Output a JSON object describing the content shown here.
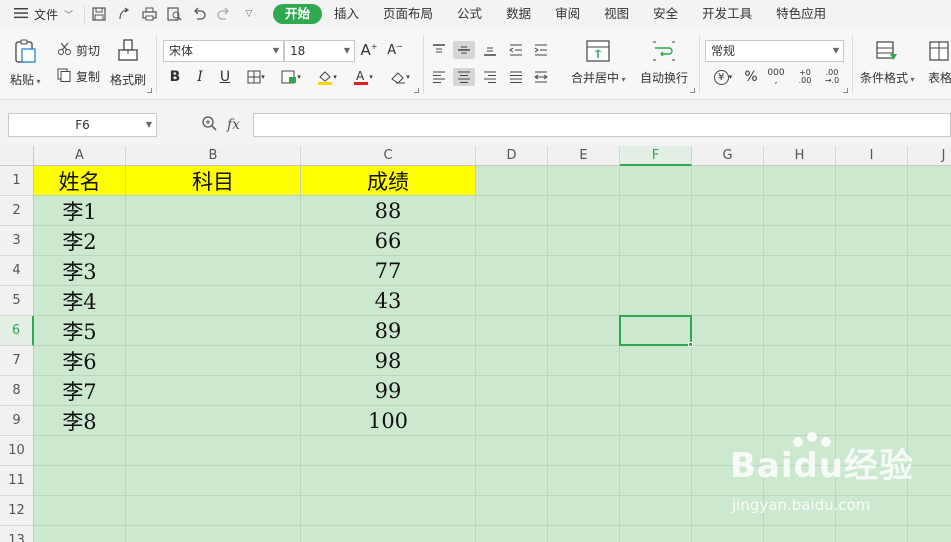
{
  "menu": {
    "file_label": "文件",
    "tabs": [
      {
        "label": "开始",
        "active": true
      },
      {
        "label": "插入"
      },
      {
        "label": "页面布局"
      },
      {
        "label": "公式"
      },
      {
        "label": "数据"
      },
      {
        "label": "审阅"
      },
      {
        "label": "视图"
      },
      {
        "label": "安全"
      },
      {
        "label": "开发工具"
      },
      {
        "label": "特色应用"
      }
    ]
  },
  "ribbon": {
    "paste": "粘贴",
    "cut": "剪切",
    "copy": "复制",
    "format_painter": "格式刷",
    "font_name": "宋体",
    "font_size": "18",
    "merge_center": "合并居中",
    "wrap_text": "自动换行",
    "number_format": "常规",
    "conditional_format": "条件格式",
    "table_style": "表格"
  },
  "formula_bar": {
    "name_box": "F6",
    "fx": "fx",
    "formula_value": ""
  },
  "sheet": {
    "columns": [
      "A",
      "B",
      "C",
      "D",
      "E",
      "F",
      "G",
      "H",
      "I",
      "J"
    ],
    "rows": [
      "1",
      "2",
      "3",
      "4",
      "5",
      "6",
      "7",
      "8",
      "9",
      "10",
      "11",
      "12",
      "13"
    ],
    "header_row": [
      "姓名",
      "科目",
      "成绩"
    ],
    "data": [
      [
        "李1",
        "",
        "88"
      ],
      [
        "李2",
        "",
        "66"
      ],
      [
        "李3",
        "",
        "77"
      ],
      [
        "李4",
        "",
        "43"
      ],
      [
        "李5",
        "",
        "89"
      ],
      [
        "李6",
        "",
        "98"
      ],
      [
        "李7",
        "",
        "99"
      ],
      [
        "李8",
        "",
        "100"
      ]
    ],
    "selected_cell": "F6"
  },
  "colors": {
    "accent": "#2fa84f",
    "header_fill": "#ffff00",
    "sheet_bg": "#cce8cf"
  },
  "watermark": {
    "brand": "Baidu经验",
    "url": "jingyan.baidu.com"
  }
}
